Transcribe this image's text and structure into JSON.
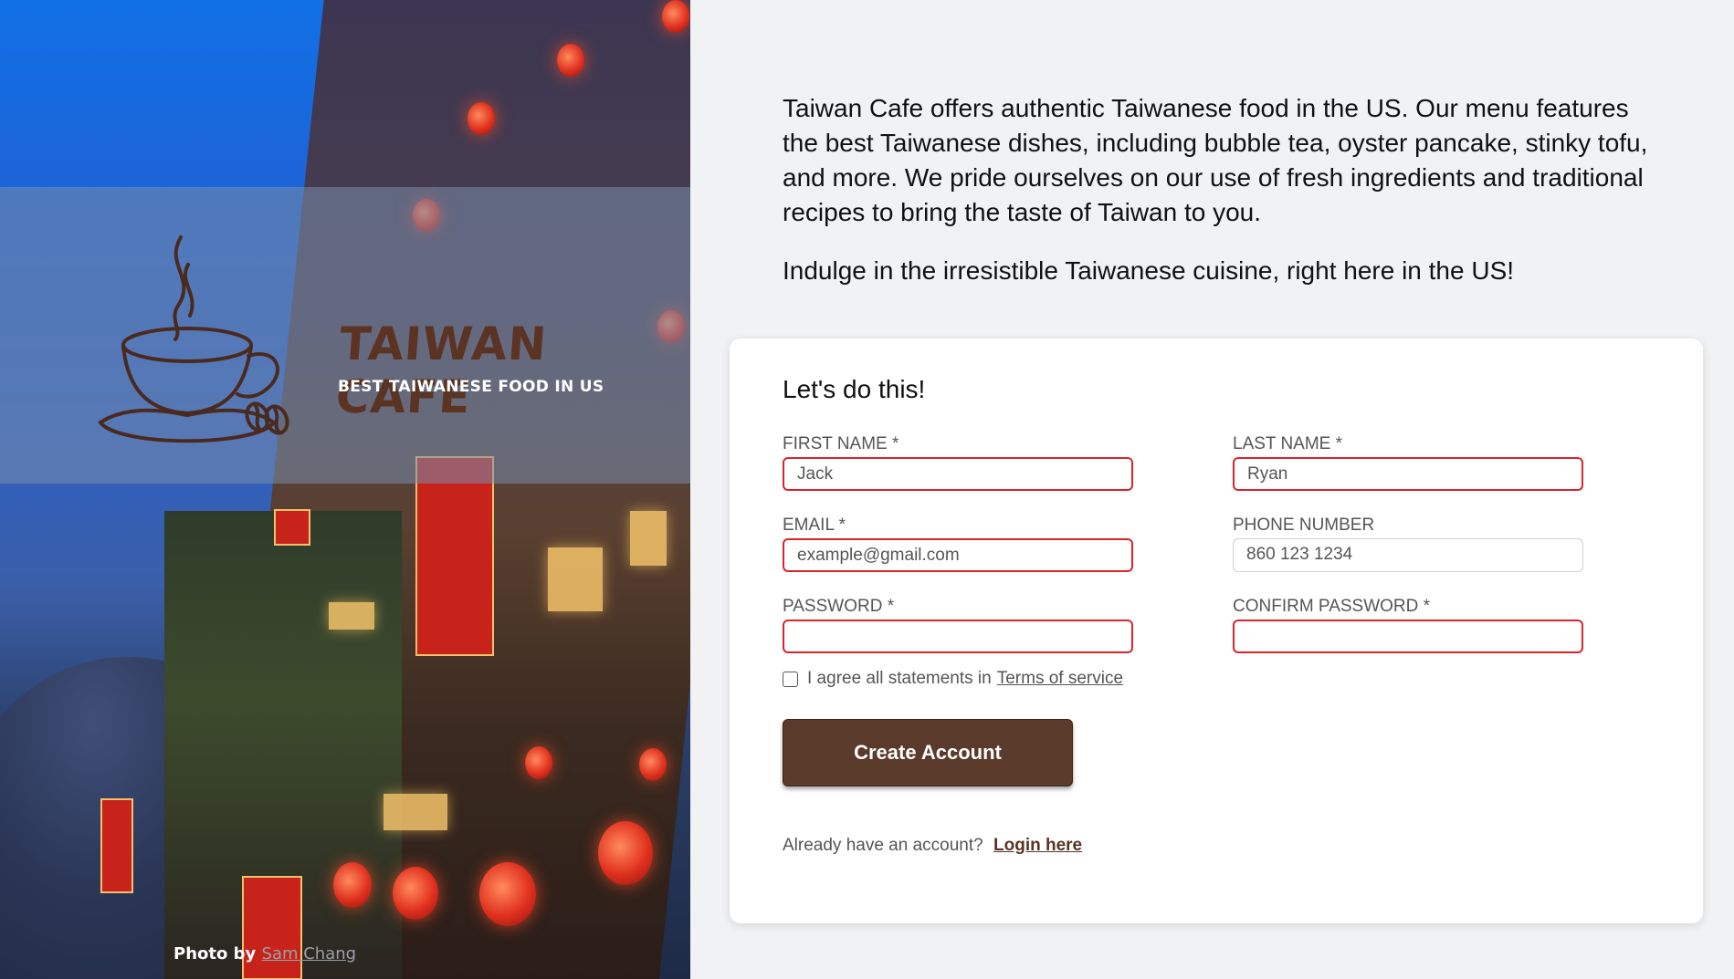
{
  "brand": {
    "title": "TAIWAN CAFE",
    "tagline": "BEST TAIWANESE FOOD IN US",
    "colors": {
      "brown": "#5a3a2a",
      "error_red": "#d9242b"
    }
  },
  "photo_credit": {
    "prefix": "Photo by",
    "author": "Sam Chang"
  },
  "intro": {
    "paragraph1": "Taiwan Cafe offers authentic Taiwanese food in the US. Our menu features the best Taiwanese dishes, including bubble tea, oyster pancake, stinky tofu, and more. We pride ourselves on our use of fresh ingredients and traditional recipes to bring the taste of Taiwan to you.",
    "paragraph2": "Indulge in the irresistible Taiwanese cuisine, right here in the US!"
  },
  "form": {
    "heading": "Let's do this!",
    "first_name": {
      "label": "FIRST NAME *",
      "placeholder": "Jack"
    },
    "last_name": {
      "label": "LAST NAME *",
      "placeholder": "Ryan"
    },
    "email": {
      "label": "EMAIL *",
      "placeholder": "example@gmail.com"
    },
    "phone": {
      "label": "PHONE NUMBER",
      "placeholder": "860 123 1234"
    },
    "password": {
      "label": "PASSWORD *",
      "placeholder": ""
    },
    "confirm_password": {
      "label": "CONFIRM PASSWORD *",
      "placeholder": ""
    },
    "terms": {
      "text": "I agree all statements in",
      "link": "Terms of service",
      "checked": false
    },
    "submit_label": "Create Account",
    "login": {
      "text": "Already have an account?",
      "link": "Login here"
    }
  },
  "icons": [
    "coffee-cup-logo-icon",
    "checkbox-icon"
  ]
}
